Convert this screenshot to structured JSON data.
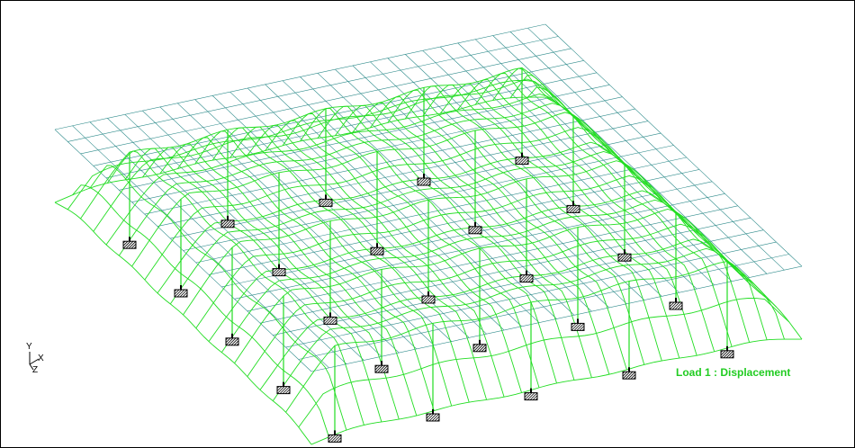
{
  "caption": {
    "text": "Load 1 : Displacement"
  },
  "axes": {
    "y": "Y",
    "x": "X",
    "z": "Z"
  },
  "colors": {
    "undeformed_mesh": "#2e8b8b",
    "deformed_mesh": "#22dd22",
    "caption": "#22cc22",
    "support": "#000000"
  },
  "mesh": {
    "columns": 28,
    "rows": 20,
    "support_columns": 5,
    "support_rows": 5
  }
}
